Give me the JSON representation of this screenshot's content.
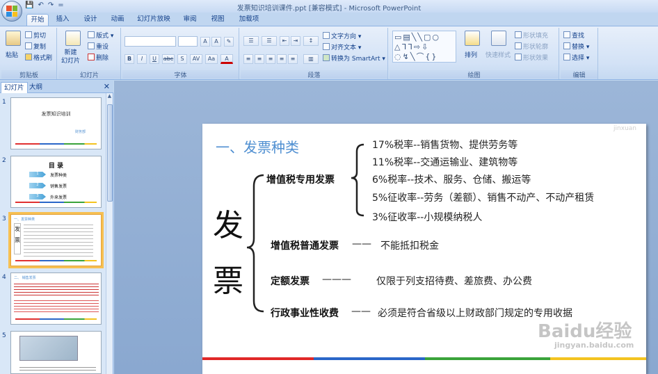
{
  "window": {
    "title": "发票知识培训课件.ppt [兼容模式] - Microsoft PowerPoint",
    "qat": [
      "💾",
      "↶",
      "↷",
      "="
    ]
  },
  "tabs": [
    "开始",
    "插入",
    "设计",
    "动画",
    "幻灯片放映",
    "审阅",
    "视图",
    "加载项"
  ],
  "ribbon": {
    "clipboard": {
      "label": "剪贴板",
      "paste": "粘贴",
      "cut": "剪切",
      "copy": "复制",
      "format_painter": "格式刷"
    },
    "slides": {
      "label": "幻灯片",
      "new_slide": "新建\n幻灯片",
      "layout": "版式",
      "reset": "重设",
      "delete": "删除"
    },
    "font": {
      "label": "字体",
      "buttons": [
        "B",
        "I",
        "U",
        "abc",
        "S",
        "AV",
        "Aa",
        "A"
      ]
    },
    "paragraph": {
      "label": "段落",
      "text_direction": "文字方向",
      "align_text": "对齐文本",
      "smartart": "转换为 SmartArt"
    },
    "drawing": {
      "label": "绘图",
      "arrange": "排列",
      "quick_styles": "快速样式",
      "shape_fill": "形状填充",
      "shape_outline": "形状轮廓",
      "shape_effects": "形状效果"
    },
    "editing": {
      "label": "编辑",
      "find": "查找",
      "replace": "替换",
      "select": "选择"
    }
  },
  "pane": {
    "tabs": [
      "幻灯片",
      "大纲"
    ],
    "close": "✕",
    "thumbs": [
      {
        "num": "1",
        "title": "发票知识培训",
        "sub": "财务部"
      },
      {
        "num": "2",
        "title": "目 录",
        "items": [
          "发票种类",
          "销售发票",
          "外来发票"
        ],
        "bullets": [
          "1",
          "2",
          "3"
        ]
      },
      {
        "num": "3",
        "title": "一、发票种类"
      },
      {
        "num": "4",
        "title": "二、 销售发票"
      },
      {
        "num": "5",
        "title": ""
      }
    ]
  },
  "slide": {
    "title": "一、发票种类",
    "big_chars": [
      "发",
      "票"
    ],
    "vat_special": {
      "label": "增值税专用发票",
      "items": [
        "17%税率--销售货物、提供劳务等",
        "11%税率--交通运输业、建筑物等",
        "6%税率--技术、服务、仓储、搬运等",
        "5%征收率--劳务（差额）、销售不动产、不动产租赁",
        "3%征收率--小规模纳税人"
      ]
    },
    "vat_normal": {
      "label": "增值税普通发票",
      "dash": "——",
      "desc": "不能抵扣税金"
    },
    "fixed": {
      "label": "定额发票",
      "dash": "———",
      "desc": "仅限于列支招待费、差旅费、办公费"
    },
    "admin": {
      "label": "行政事业性收费",
      "dash": "——",
      "desc": "必须是符合省级以上财政部门规定的专用收据"
    },
    "watermark_top": "jinxuan",
    "watermark_brand": "Baidu经验",
    "watermark_url": "jingyan.baidu.com"
  }
}
